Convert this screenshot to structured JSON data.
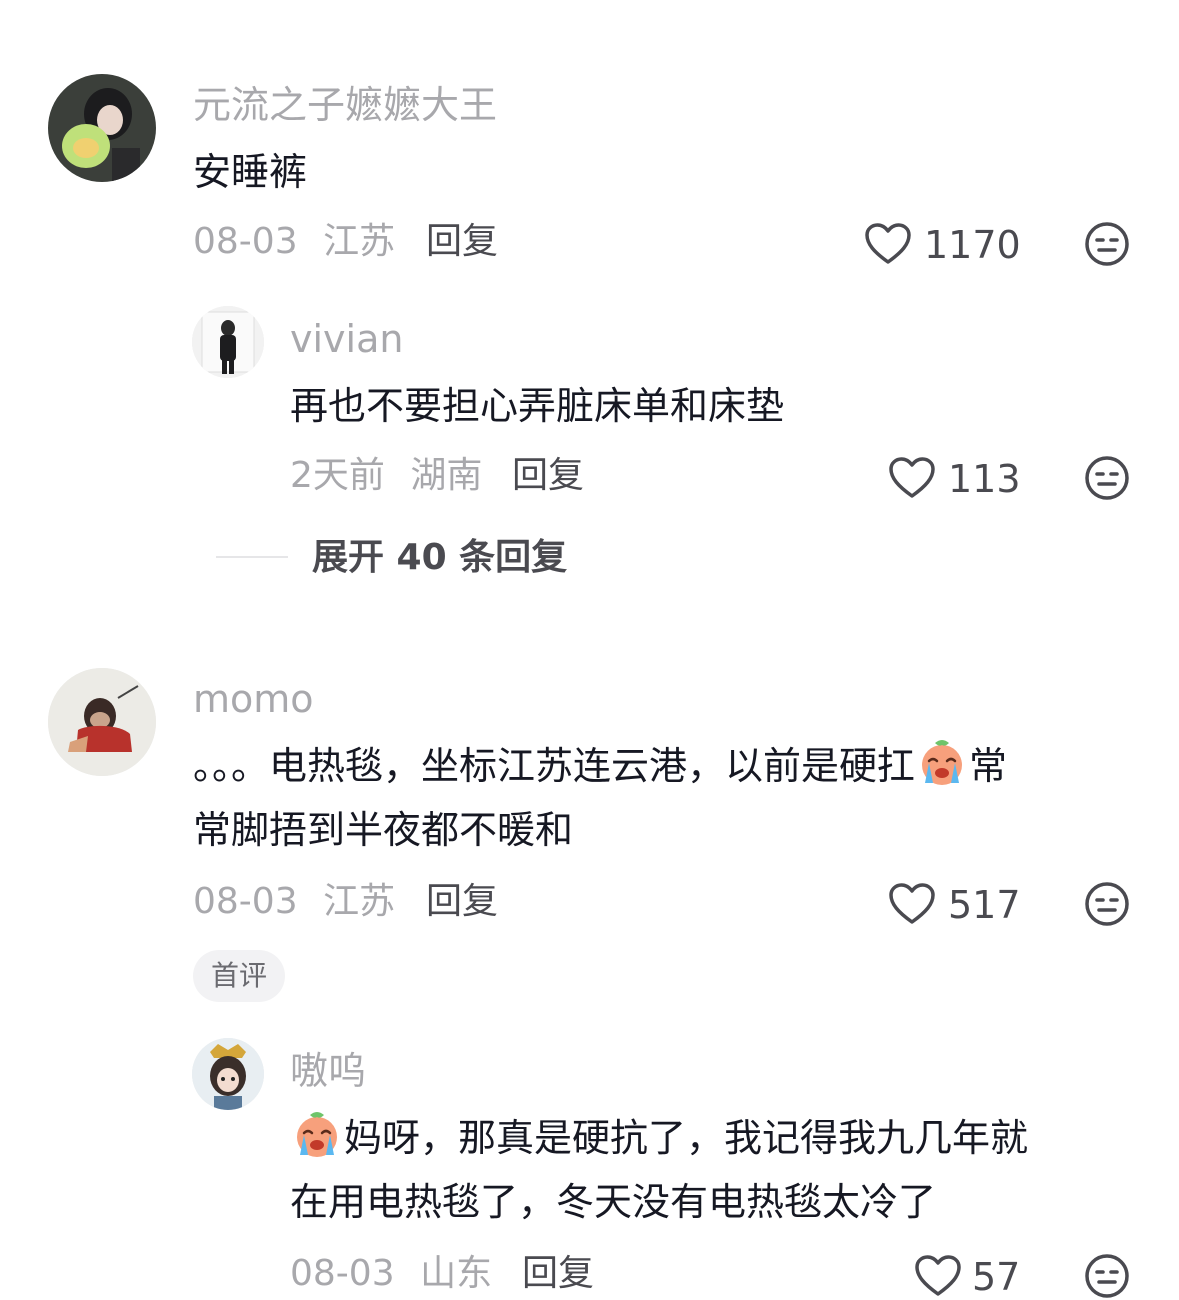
{
  "comments": [
    {
      "username": "元流之子嬷嬷大王",
      "text": "安睡裤",
      "date": "08-03",
      "location": "江苏",
      "reply_label": "回复",
      "likes": "1170",
      "replies": [
        {
          "username": "vivian",
          "text": "再也不要担心弄脏床单和床垫",
          "date": "2天前",
          "location": "湖南",
          "reply_label": "回复",
          "likes": "113"
        }
      ],
      "expand_label": "展开 40 条回复"
    },
    {
      "username": "momo",
      "text_before_emoji": "。。。电热毯，坐标江苏连云港，以前是硬扛",
      "text_after_emoji": "常",
      "text_line2": "常脚捂到半夜都不暖和",
      "date": "08-03",
      "location": "江苏",
      "reply_label": "回复",
      "likes": "517",
      "badge": "首评",
      "replies": [
        {
          "username": "嗷呜",
          "text_line1": "妈呀，那真是硬抗了，我记得我九几年就",
          "text_line2": "在用电热毯了，冬天没有电热毯太冷了",
          "date": "08-03",
          "location": "山东",
          "reply_label": "回复",
          "likes": "57"
        }
      ]
    }
  ],
  "icons": {
    "like": "heart-outline-icon",
    "dislike": "meh-face-icon",
    "emoji": "crying-face-emoji"
  },
  "colors": {
    "username": "#a8a8ac",
    "text": "#161823",
    "meta": "#a8a8ac",
    "action": "#4a4a50"
  }
}
